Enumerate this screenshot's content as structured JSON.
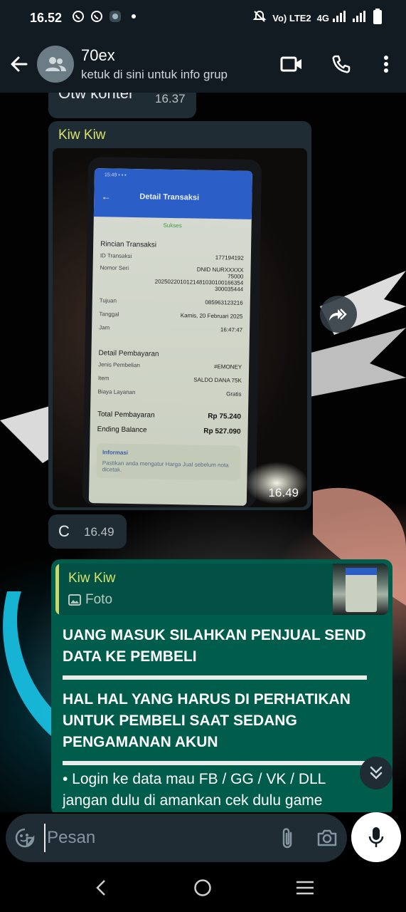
{
  "status_bar": {
    "time": "16.52",
    "network_label": "Vo) LTE2",
    "network_type": "4G"
  },
  "header": {
    "title": "70ex",
    "subtitle": "ketuk di sini untuk info grup"
  },
  "messages": [
    {
      "type": "incoming",
      "text": "Otw konter",
      "time": "16.37"
    },
    {
      "type": "incoming-photo",
      "sender": "Kiw Kiw",
      "time": "16.49",
      "photo": {
        "screen_title": "Detail Transaksi",
        "status": "Sukses",
        "rincian_title": "Rincian Transaksi",
        "rows": [
          {
            "label": "ID Transaksi",
            "value": "177194192"
          },
          {
            "label": "Nomor Seri",
            "value": "DNID NURXXXXX"
          },
          {
            "label": "",
            "value": "75000"
          },
          {
            "label": "",
            "value": "2025022010121481030100166354"
          },
          {
            "label": "",
            "value": "300035444"
          },
          {
            "label": "Tujuan",
            "value": "085963123216"
          },
          {
            "label": "Tanggal",
            "value": "Kamis, 20 Februari 2025"
          },
          {
            "label": "Jam",
            "value": "16:47:47"
          }
        ],
        "payment_title": "Detail Pembayaran",
        "payment_rows": [
          {
            "label": "Jenis Pembelian",
            "value": "#EMONEY"
          },
          {
            "label": "Item",
            "value": "SALDO DANA 75K"
          },
          {
            "label": "Biaya Layanan",
            "value": "Gratis"
          }
        ],
        "totals": [
          {
            "label": "Total Pembayaran",
            "value": "Rp 75.240"
          },
          {
            "label": "Ending Balance",
            "value": "Rp 527.090"
          }
        ],
        "info_title": "Informasi",
        "info_body": "Pastikan anda mengatur Harga Jual sebelum nota dicetak."
      }
    },
    {
      "type": "incoming",
      "text": "C",
      "time": "16.49"
    },
    {
      "type": "outgoing-reply",
      "quote": {
        "sender": "Kiw Kiw",
        "kind": "Foto"
      },
      "heading1": "UANG MASUK SILAHKAN PENJUAL SEND DATA KE PEMBELI",
      "heading2": "HAL HAL YANG HARUS DI PERHATIKAN UNTUK PEMBELI SAAT SEDANG PENGAMANAN AKUN",
      "body_line1": "• Login ke data mau FB / GG / VK / DLL",
      "body_line2": "jangan dulu di amankan cek dulu game"
    }
  ],
  "composer": {
    "placeholder": "Pesan"
  },
  "icons": {
    "back": "arrow-left-icon",
    "group": "group-avatar-icon",
    "video": "video-call-icon",
    "call": "phone-icon",
    "menu": "more-vert-icon",
    "forward": "forward-icon",
    "emoji": "sticker-icon",
    "attach": "paperclip-icon",
    "camera": "camera-icon",
    "mic": "mic-icon",
    "scroll": "double-chevron-down-icon"
  },
  "colors": {
    "header_bg": "#111b21",
    "incoming_bubble": "#1f2c34",
    "outgoing_bubble": "#005c4b",
    "sender_name": "#d9e36b",
    "mic_button": "#ffffff"
  }
}
